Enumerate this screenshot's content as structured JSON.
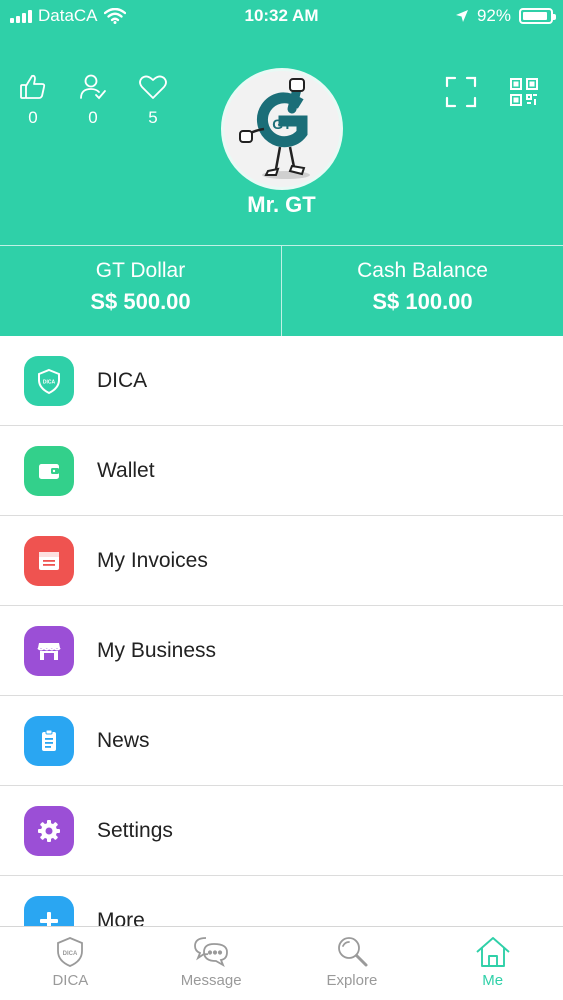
{
  "status_bar": {
    "carrier": "DataCA",
    "time": "10:32 AM",
    "battery": "92%",
    "battery_level": 0.92
  },
  "profile": {
    "name": "Mr. GT",
    "avatar_logo": "GT",
    "stats": [
      {
        "icon": "thumbs-up-icon",
        "value": "0"
      },
      {
        "icon": "followers-icon",
        "value": "0"
      },
      {
        "icon": "heart-icon",
        "value": "5"
      }
    ]
  },
  "balances": {
    "gt_dollar": {
      "label": "GT Dollar",
      "amount": "S$ 500.00"
    },
    "cash": {
      "label": "Cash Balance",
      "amount": "S$ 100.00"
    }
  },
  "menu": {
    "items": [
      {
        "label": "DICA",
        "icon": "shield-icon",
        "color": "#2fd0a8"
      },
      {
        "label": "Wallet",
        "icon": "wallet-icon",
        "color": "#33d08b"
      },
      {
        "label": "My Invoices",
        "icon": "invoice-icon",
        "color": "#ef5350"
      },
      {
        "label": "My Business",
        "icon": "store-icon",
        "color": "#9b4fd6"
      },
      {
        "label": "News",
        "icon": "news-icon",
        "color": "#2aa6f2"
      },
      {
        "label": "Settings",
        "icon": "gear-icon",
        "color": "#9b4fd6"
      },
      {
        "label": "More",
        "icon": "plus-icon",
        "color": "#2aa6f2"
      }
    ]
  },
  "tabbar": {
    "tabs": [
      {
        "label": "DICA",
        "icon": "shield-icon"
      },
      {
        "label": "Message",
        "icon": "chat-icon"
      },
      {
        "label": "Explore",
        "icon": "search-icon"
      },
      {
        "label": "Me",
        "icon": "home-icon",
        "active": true
      }
    ]
  },
  "colors": {
    "brand": "#2fd0a8",
    "tab_inactive": "#9a9a9a"
  }
}
